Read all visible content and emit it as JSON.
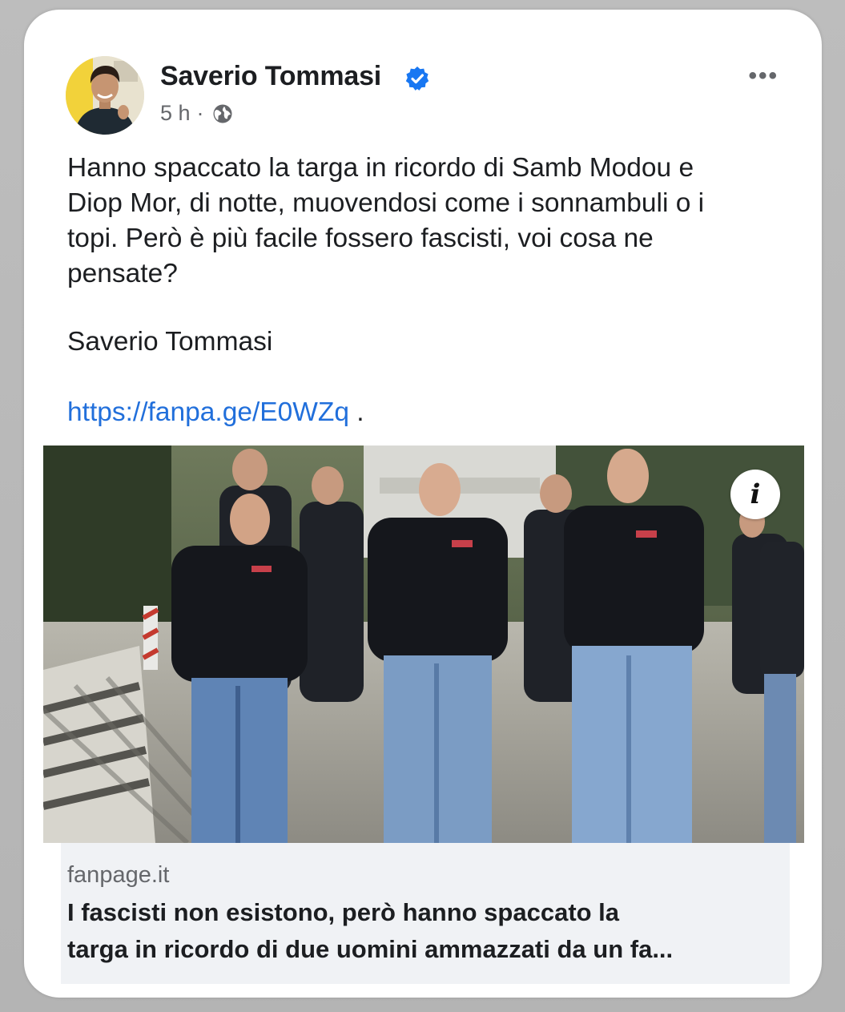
{
  "post": {
    "author": "Saverio Tommasi",
    "time": "5 h",
    "separator": "·",
    "text_lines": [
      "Hanno spaccato la targa in ricordo di Samb Modou e",
      "Diop Mor, di notte, muovendosi come i sonnambuli o i",
      "topi. Però è più facile fossero fascisti, voi cosa ne",
      "pensate?"
    ],
    "signature": "Saverio Tommasi",
    "link": "https://fanpa.ge/E0WZq",
    "link_suffix": " .",
    "more_label": "•••"
  },
  "preview": {
    "info_label": "i",
    "domain": "fanpage.it",
    "headline_lines": [
      "I fascisti non esistono, però hanno spaccato la",
      "targa in ricordo di due uomini ammazzati da un fa..."
    ]
  },
  "icons": {
    "verified": "verified-badge-icon",
    "audience": "globe-icon",
    "more": "more-options-icon",
    "info": "info-icon"
  },
  "colors": {
    "link": "#216fdb",
    "verified": "#1877f2",
    "secondary_text": "#65676b"
  }
}
